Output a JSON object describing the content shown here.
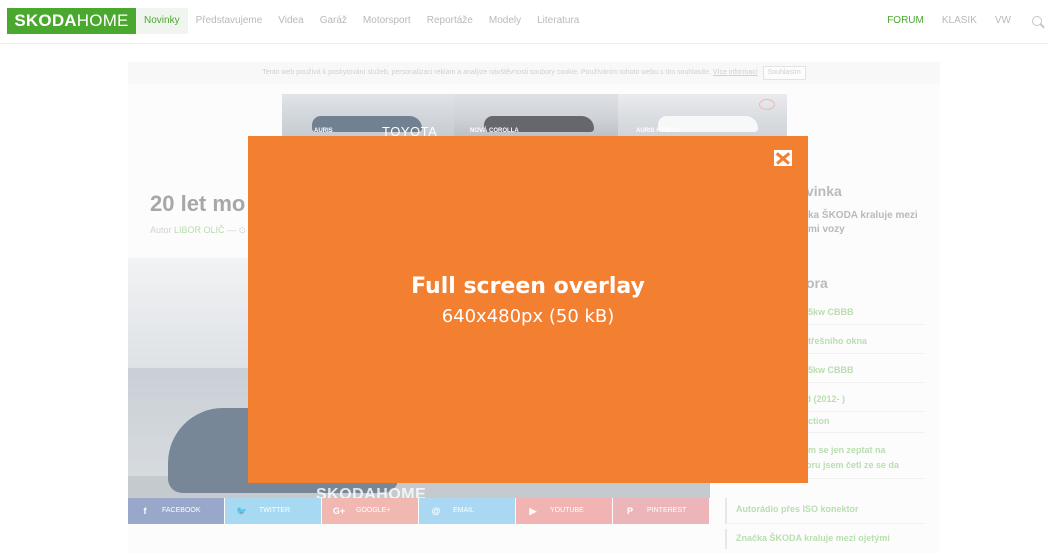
{
  "brand": {
    "bold": "SKODA",
    "light": "HOME",
    "color": "#4ba82e"
  },
  "nav": {
    "items": [
      "Novinky",
      "Představujeme",
      "Videa",
      "Garáž",
      "Motorsport",
      "Reportáže",
      "Modely",
      "Literatura"
    ],
    "active": "Novinky",
    "right": [
      "FORUM",
      "KLASIK",
      "VW"
    ],
    "search_icon": "search-icon"
  },
  "cookie": {
    "text": "Tento web používá k poskytování služeb, personalizaci reklam a analýze návštěvnosti soubory cookie. Používáním tohoto webu s tím souhlasíte.",
    "more": "Více informací",
    "agree": "Souhlasím"
  },
  "ad": {
    "labels": [
      "AURIS",
      "NOVÁ COROLLA",
      "AURIS HYBRID"
    ],
    "brand": "TOYOTA"
  },
  "article": {
    "title_fragment": "20 let mo",
    "author_prefix": "Autor",
    "author_name": "LIBOR OLIČ",
    "author_suffix": "— ⊙",
    "watermark": "SKODAHOME"
  },
  "share": [
    {
      "label": "FACEBOOK",
      "icon": "f",
      "icon_name": "facebook-icon",
      "color": "#7c8fbc"
    },
    {
      "label": "TWITTER",
      "icon": "🐦",
      "icon_name": "twitter-icon",
      "color": "#8fd0ef"
    },
    {
      "label": "GOOGLE+",
      "icon": "G+",
      "icon_name": "google-plus-icon",
      "color": "#eea59b"
    },
    {
      "label": "EMAIL",
      "icon": "@",
      "icon_name": "email-icon",
      "color": "#93cdef"
    },
    {
      "label": "YOUTUBE",
      "icon": "▶",
      "icon_name": "youtube-icon",
      "color": "#ee9f9d"
    },
    {
      "label": "PINTEREST",
      "icon": "P",
      "icon_name": "pinterest-icon",
      "color": "#e7a1a6"
    }
  ],
  "sidebar": {
    "heading1_fragment": "vinka",
    "text1_line1": "ka ŠKODA kraluje mezi",
    "text1_line2": "mi vozy",
    "heading2_fragment": "ora",
    "links": [
      "25kw CBBB",
      "střešního okna",
      "25kw CBBB",
      "ld (2012- )",
      "ection",
      "em se jen zeptat na",
      "foru jsem četl ze se da",
      "Autorádio přes ISO konektor",
      "Značka ŠKODA kraluje mezi ojetými"
    ]
  },
  "overlay": {
    "title": "Full screen overlay",
    "subtitle": "640x480px (50 kB)",
    "color": "#f37f31",
    "close_icon": "close-icon"
  }
}
